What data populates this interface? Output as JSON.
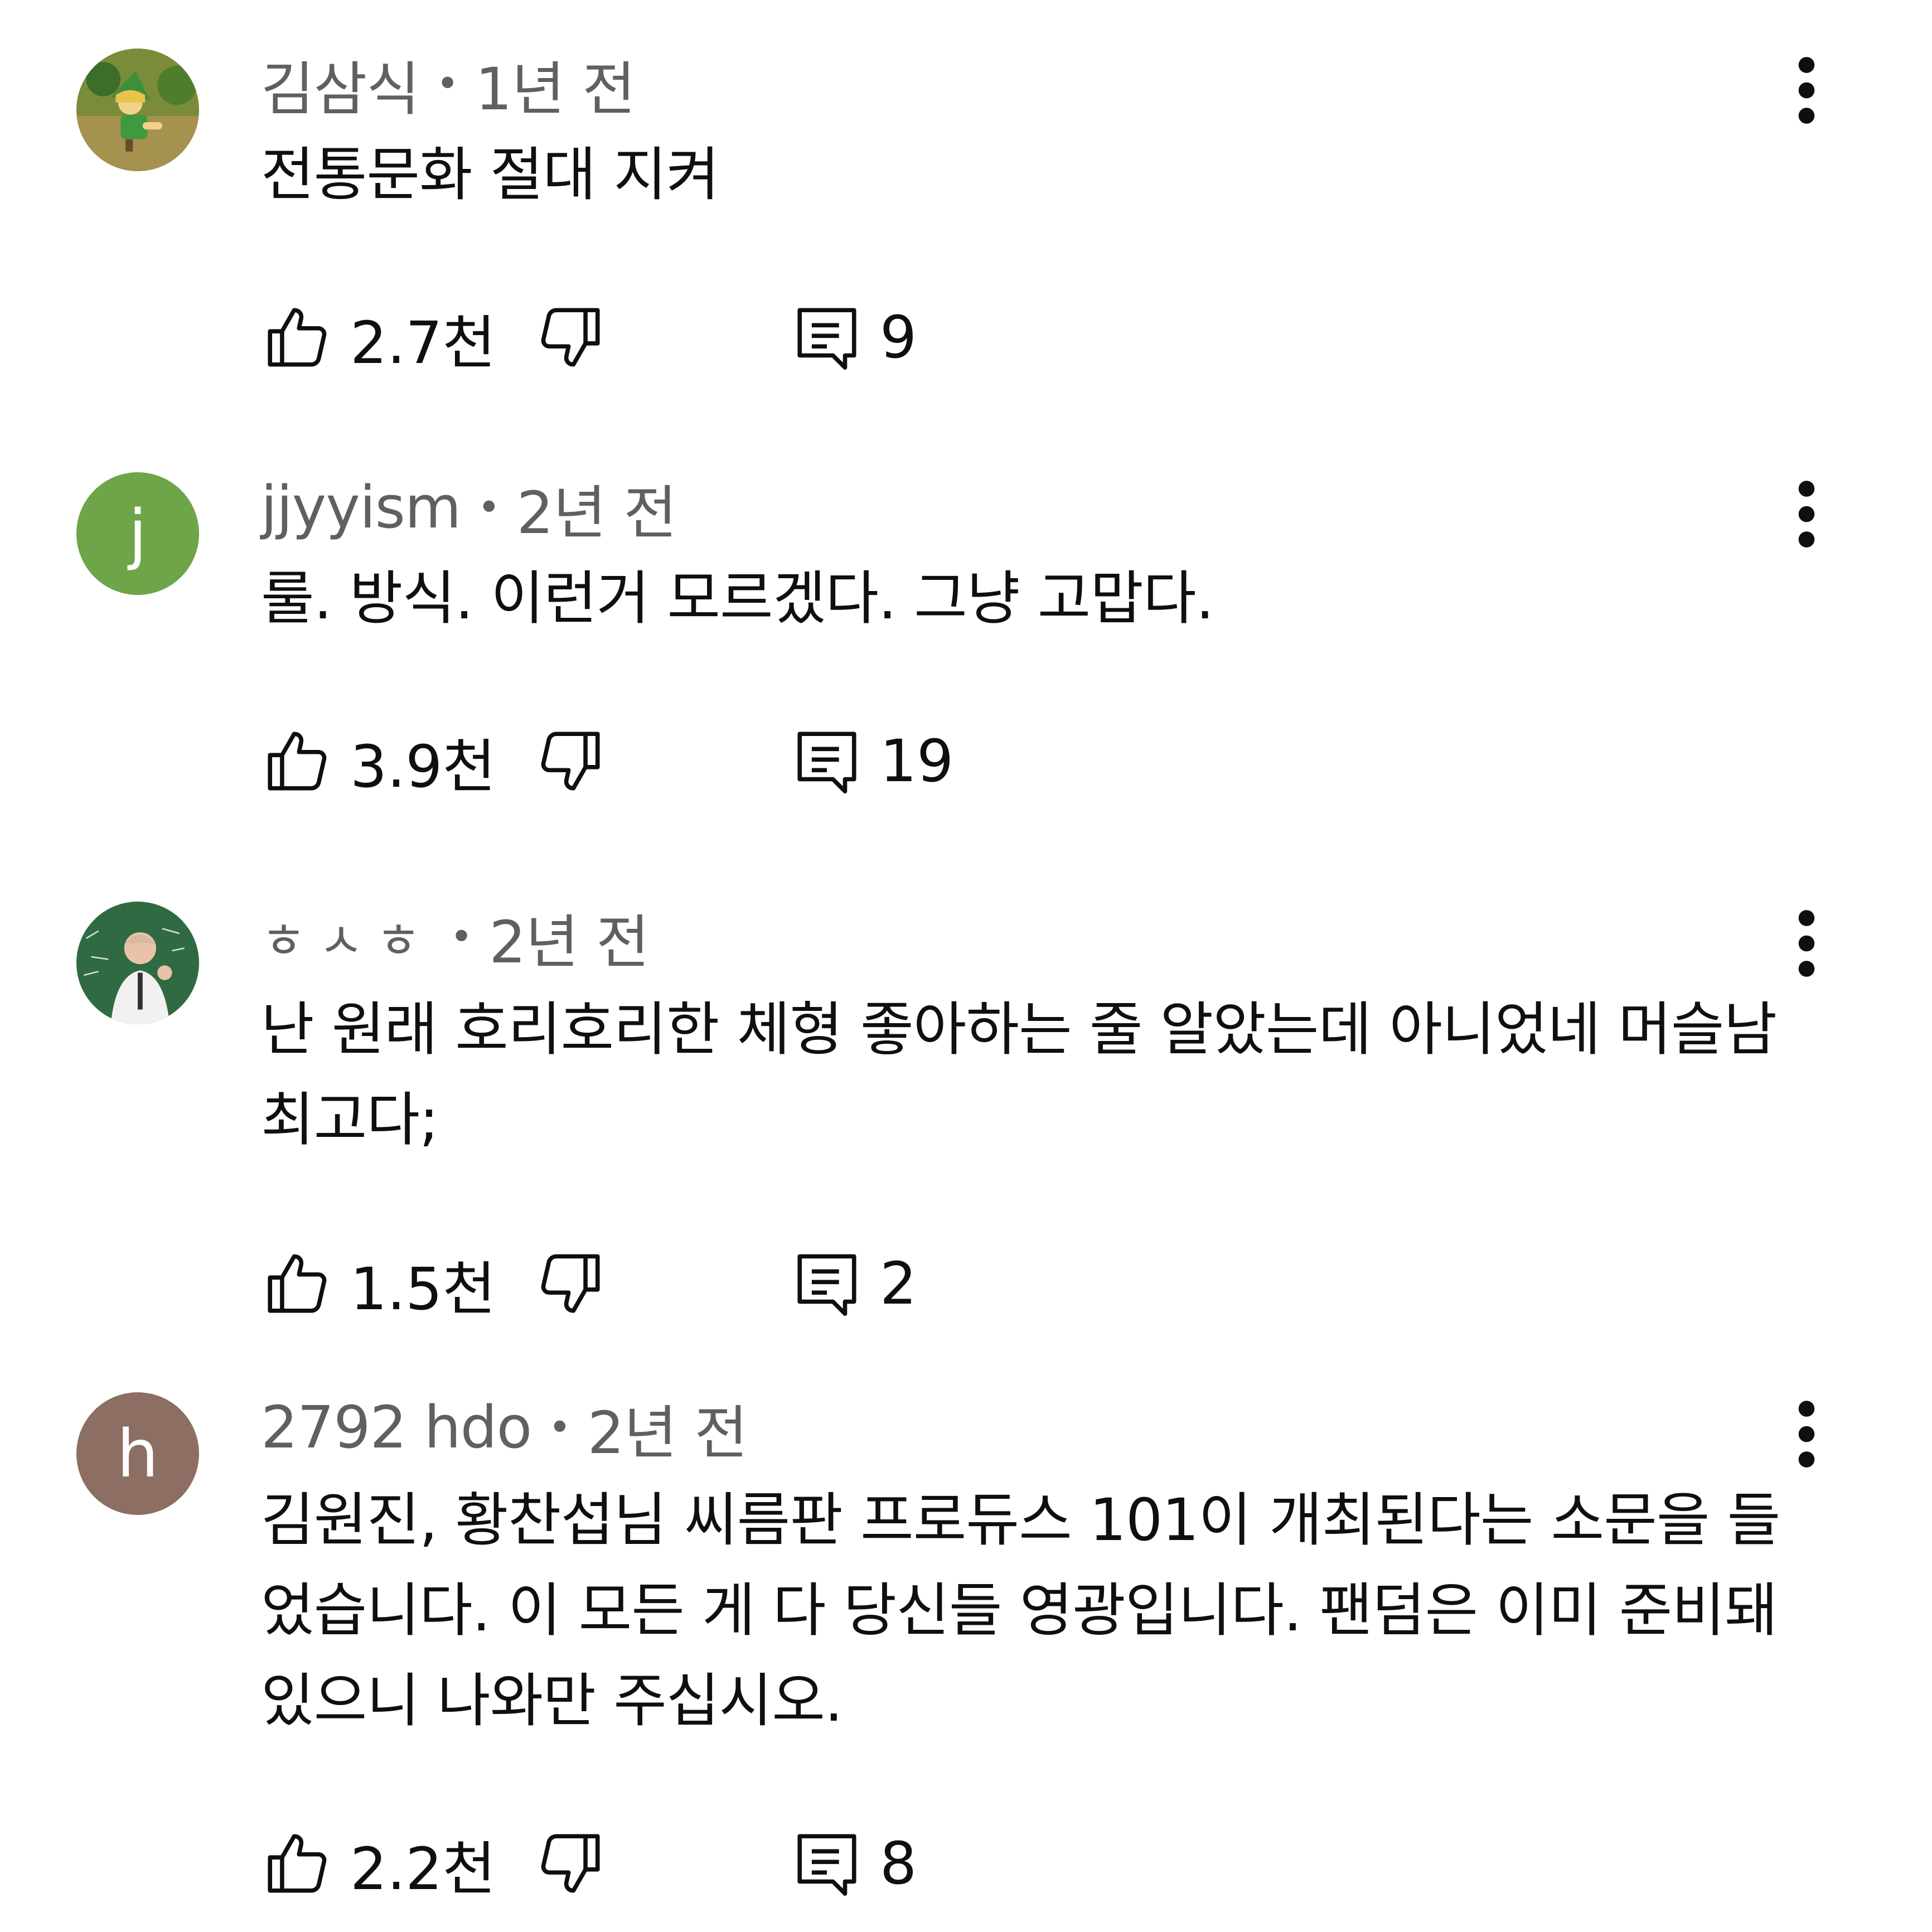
{
  "colors": {
    "avatar_j": "#6ea548",
    "avatar_h": "#8d6e63",
    "text": "#0f0f0f",
    "meta": "#606060"
  },
  "comments": [
    {
      "author": "김삼식",
      "time": "1년 전",
      "text": "전통문화 절대 지켜",
      "likes": "2.7천",
      "replies": "9",
      "avatar": {
        "type": "image",
        "icon": "cartoon-character-avatar"
      }
    },
    {
      "author": "jjyyism",
      "time": "2년 전",
      "text": "룰. 방식. 이런거 모르겠다. 그냥 고맙다.",
      "likes": "3.9천",
      "replies": "19",
      "avatar": {
        "type": "letter",
        "letter": "j"
      }
    },
    {
      "author": "ㅎㅅㅎ",
      "time": "2년 전",
      "text": "난 원래 호리호리한 체형 좋아하는 줄 알았는데 아니었네 머슬남 최고다;",
      "likes": "1.5천",
      "replies": "2",
      "avatar": {
        "type": "image",
        "icon": "teacher-photo-avatar"
      }
    },
    {
      "author": "2792 hdo",
      "time": "2년 전",
      "text": "김원진, 황찬섭님 씨름판 프로듀스 101이 개최된다는 소문을 들었습니다. 이 모든 게 다 당신들 영광입니다. 팬덤은 이미 준비돼 있으니 나와만 주십시오.",
      "likes": "2.2천",
      "replies": "8",
      "avatar": {
        "type": "letter",
        "letter": "h"
      }
    }
  ]
}
